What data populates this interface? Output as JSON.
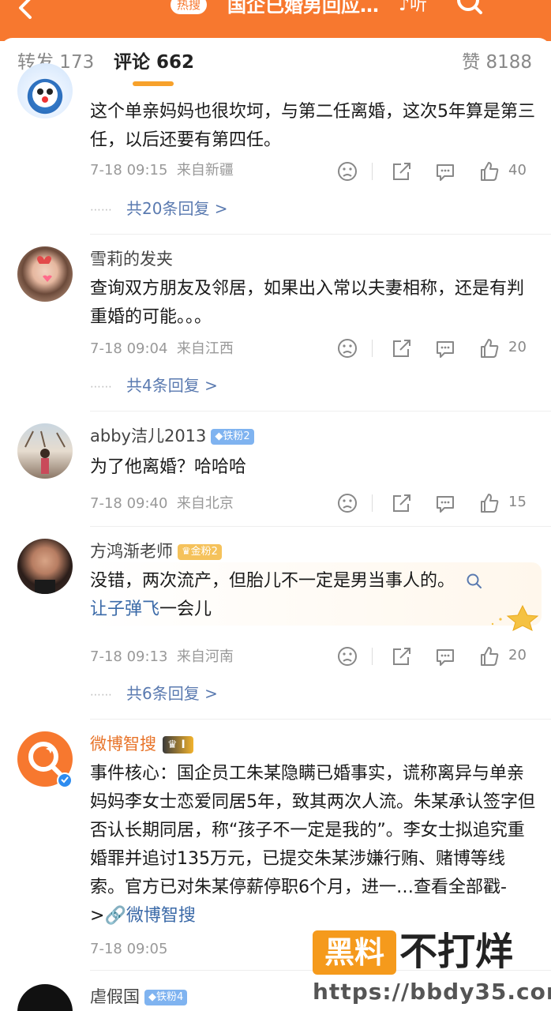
{
  "header": {
    "hot_badge": "热搜",
    "title": "国企已婚男回应…",
    "listen_label": "听"
  },
  "tabs": {
    "repost": "转发 173",
    "comment": "评论 662",
    "like": "赞 8188"
  },
  "comments": [
    {
      "name": "",
      "text": "这个单亲妈妈也很坎坷，与第二任离婚，这次5年算是第三任，以后还要有第四任。",
      "time": "7-18 09:15",
      "location": "来自新疆",
      "likes": "40",
      "replies": "共20条回复 >"
    },
    {
      "name": "雪莉的发夹",
      "text": "查询双方朋友及邻居，如果出入常以夫妻相称，还是有判重婚的可能。。。",
      "time": "7-18 09:04",
      "location": "来自江西",
      "likes": "20",
      "replies": "共4条回复 >"
    },
    {
      "name": "abby洁儿2013",
      "badge": "铁粉2",
      "text": "为了他离婚？哈哈哈",
      "time": "7-18 09:40",
      "location": "来自北京",
      "likes": "15"
    },
    {
      "name": "方鸿渐老师",
      "badge": "金粉2",
      "text_line1": "没错，两次流产，但胎儿不一定是男当事人的。",
      "text_link": "让子弹飞",
      "text_tail": "一会儿",
      "time": "7-18 09:13",
      "location": "来自河南",
      "likes": "20",
      "replies": "共6条回复 >"
    },
    {
      "name": "微博智搜",
      "badge": "I",
      "text": "事件核心：国企员工朱某隐瞒已婚事实，谎称离异与单亲妈妈李女士恋爱同居5年，致其两次人流。朱某承认签字但否认长期同居，称“孩子不一定是我的”。李女士拟追究重婚罪并追讨135万元，已提交朱某涉嫌行贿、赌博等线索。官方已对朱某停薪停职6个月，进一…",
      "more": "查看全部戳->",
      "source": "微博智搜",
      "time": "7-18 09:05"
    },
    {
      "name": "虐假国",
      "badge": "铁粉4"
    }
  ],
  "watermark": {
    "box": "黑料",
    "text": "不打烊",
    "url": "https://bbdy35.com"
  }
}
